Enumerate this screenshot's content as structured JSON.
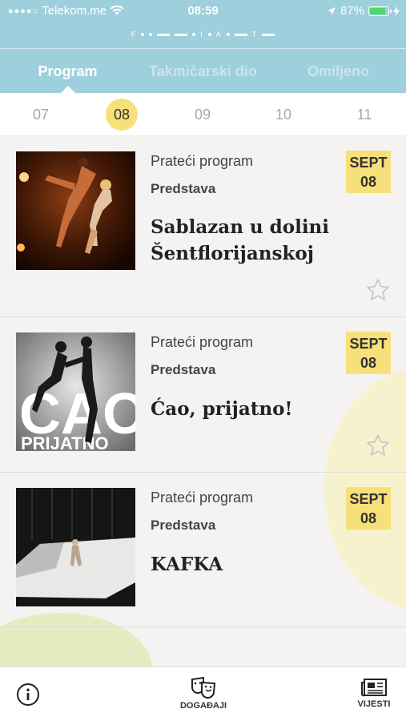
{
  "status_bar": {
    "carrier": "Telekom.me",
    "time": "08:59",
    "battery": "87%",
    "battery_level": 0.87
  },
  "logo": {
    "letters": [
      "F",
      "I",
      "A",
      "T"
    ]
  },
  "tabs": [
    {
      "label": "Program",
      "active": true
    },
    {
      "label": "Takmičarski dio",
      "active": false
    },
    {
      "label": "Omiljeno",
      "active": false
    }
  ],
  "dates": [
    {
      "label": "07",
      "active": false
    },
    {
      "label": "08",
      "active": true
    },
    {
      "label": "09",
      "active": false
    },
    {
      "label": "10",
      "active": false
    },
    {
      "label": "11",
      "active": false
    }
  ],
  "events": [
    {
      "category": "Prateći program",
      "type": "Predstava",
      "title": "Sablazan u dolini Šentflorijanskoj",
      "month": "SEPT",
      "day": "08",
      "image": "dancers-orange-stage"
    },
    {
      "category": "Prateći program",
      "type": "Predstava",
      "title": "Ćao, prijatno!",
      "month": "SEPT",
      "day": "08",
      "image": "poster-bw-jumping-figures",
      "poster_text": [
        "ĆAO",
        "PRIJATNO"
      ]
    },
    {
      "category": "Prateći program",
      "type": "Predstava",
      "title": "KAFKA",
      "month": "SEPT",
      "day": "08",
      "image": "dark-stage-white-floor"
    }
  ],
  "bottom_nav": {
    "info": {
      "icon": "info-icon"
    },
    "events": {
      "label": "DOGAĐAJI",
      "icon": "theater-masks-icon"
    },
    "news": {
      "label": "VIJESTI",
      "icon": "newspaper-icon"
    }
  },
  "colors": {
    "header": "#9ecfdc",
    "accent_yellow": "#f7e07a",
    "background": "#f4f3f1"
  }
}
